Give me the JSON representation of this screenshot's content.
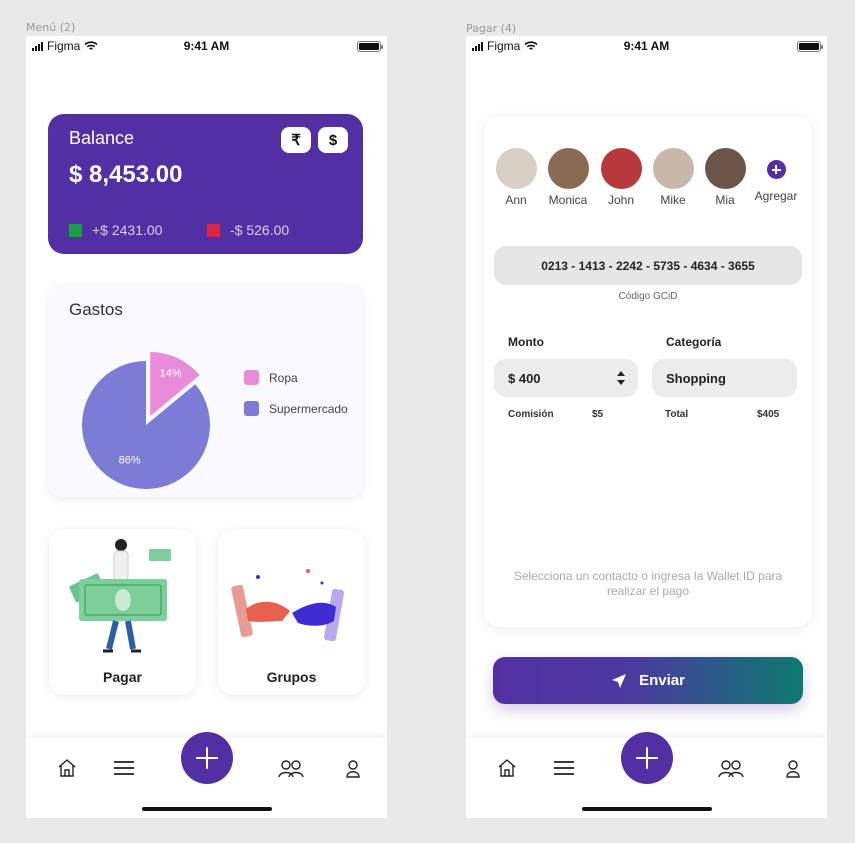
{
  "frames": {
    "menu_label": "Menú (2)",
    "pay_label": "Pagar (4)"
  },
  "status_bar": {
    "carrier": "Figma",
    "time": "9:41 AM"
  },
  "balance": {
    "title": "Balance",
    "amount": "$ 8,453.00",
    "currency_buttons": [
      "₹",
      "$"
    ],
    "income": "+$ 2431.00",
    "expense": "-$ 526.00",
    "income_color": "#1f9a4a",
    "expense_color": "#d8264e"
  },
  "gastos": {
    "title": "Gastos",
    "chart_data": {
      "type": "pie",
      "categories": [
        "Ropa",
        "Supermercado"
      ],
      "values": [
        14,
        86
      ],
      "labels": [
        "14%",
        "86%"
      ],
      "colors": [
        "#e88bd8",
        "#7c7cd6"
      ],
      "legend_position": "right"
    }
  },
  "tiles": {
    "pay": "Pagar",
    "groups": "Grupos"
  },
  "nav": {
    "items": [
      "home-icon",
      "menu-icon",
      "add-icon",
      "groups-icon",
      "profile-icon"
    ]
  },
  "pay": {
    "contacts": [
      {
        "name": "Ann",
        "color": "#d8cfc4"
      },
      {
        "name": "Monica",
        "color": "#8a6a52"
      },
      {
        "name": "John",
        "color": "#b8393b"
      },
      {
        "name": "Mike",
        "color": "#c9b8a9"
      },
      {
        "name": "Mia",
        "color": "#6c5548"
      }
    ],
    "add_label": "Agregar",
    "gcid_value": "0213 - 1413 - 2242 - 5735 - 4634 - 3655",
    "gcid_label": "Código GCiD",
    "amount_label": "Monto",
    "amount_value": "$ 400",
    "category_label": "Categoría",
    "category_value": "Shopping",
    "commission_label": "Comisión",
    "commission_value": "$5",
    "total_label": "Total",
    "total_value": "$405",
    "hint": "Selecciona un contacto o ingresa la Wallet ID para realizar el pago",
    "send_label": "Enviar"
  },
  "accent": "#5230a3"
}
